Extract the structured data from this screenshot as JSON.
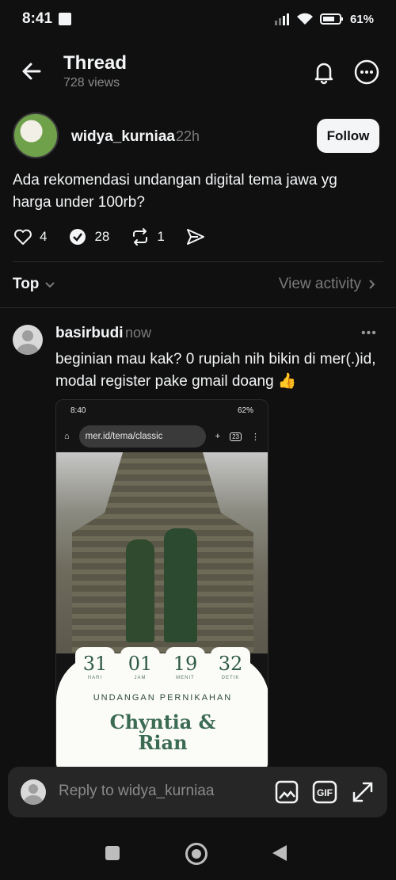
{
  "status": {
    "time": "8:41",
    "battery": "61%"
  },
  "header": {
    "title": "Thread",
    "views": "728 views"
  },
  "post": {
    "username": "widya_kurniaa",
    "time": "22h",
    "follow_label": "Follow",
    "text": "Ada rekomendasi undangan digital tema jawa yg harga under 100rb?",
    "likes": "4",
    "replies": "28",
    "reposts": "1"
  },
  "sort": {
    "label": "Top",
    "activity": "View activity"
  },
  "reply": {
    "username": "basirbudi",
    "time": "now",
    "more": "•••",
    "text": "beginian mau kak? 0 rupiah nih bikin di mer(.)id, modal register pake gmail doang 👍"
  },
  "screenshot": {
    "status_time": "8:40",
    "status_battery": "62%",
    "url": "mer.id/tema/classic",
    "tab_count": "23",
    "counters": [
      {
        "value": "31",
        "label": "HARI"
      },
      {
        "value": "01",
        "label": "JAM"
      },
      {
        "value": "19",
        "label": "MENIT"
      },
      {
        "value": "32",
        "label": "DETIK"
      }
    ],
    "heading": "UNDANGAN PERNIKAHAN",
    "names_line1": "Chyntia &",
    "names_line2": "Rian"
  },
  "replybar": {
    "placeholder": "Reply to widya_kurniaa"
  },
  "colors": {
    "background": "#101010",
    "text": "#f3f5f7",
    "muted": "#7a7a7a",
    "accent_green": "#3b6b52"
  }
}
